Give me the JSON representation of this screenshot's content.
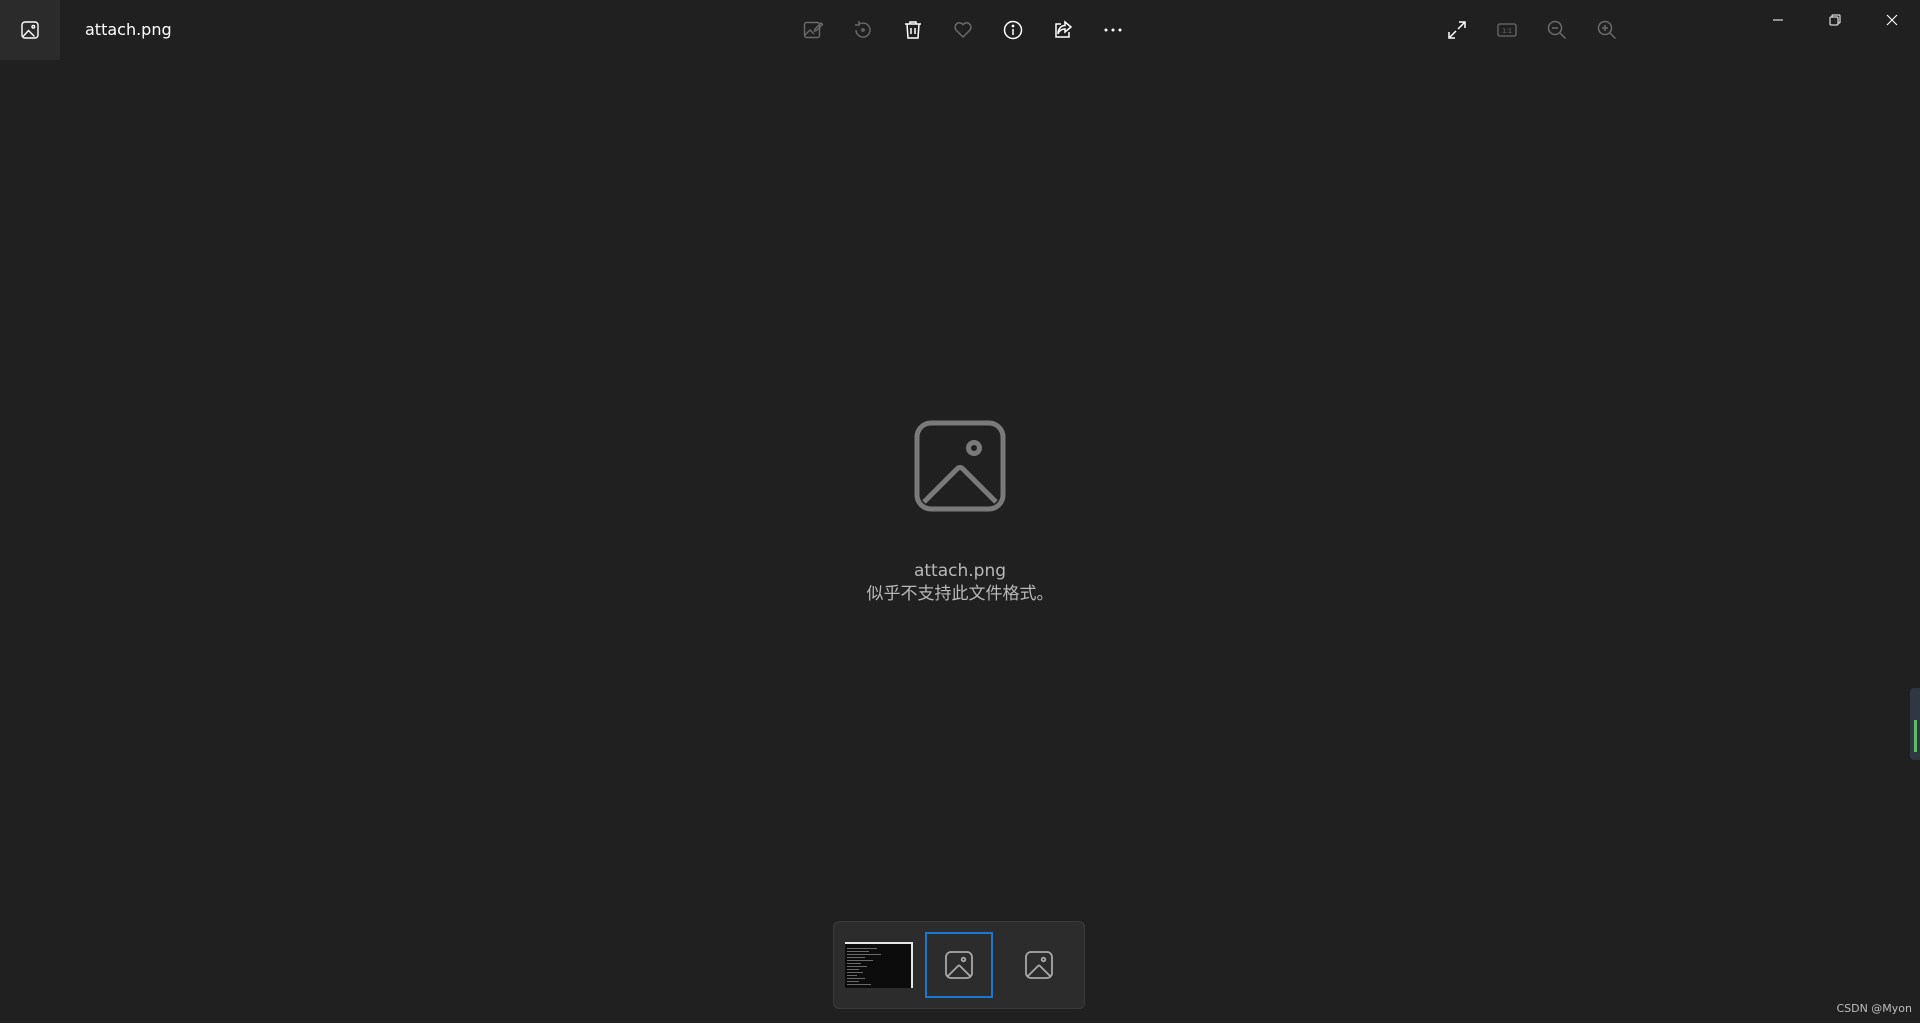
{
  "titlebar": {
    "file_name": "attach.png",
    "app_icon": "photos-app-icon"
  },
  "toolbar": {
    "center_icons": [
      "edit-image-icon",
      "rotate-icon",
      "delete-icon",
      "favorite-icon",
      "info-icon",
      "share-icon",
      "more-icon"
    ],
    "right_icons": [
      "fullscreen-icon",
      "actual-size-icon",
      "zoom-out-icon",
      "zoom-in-icon"
    ],
    "actual_size_label": "1:1"
  },
  "window_controls": [
    "minimize-icon",
    "restore-icon",
    "close-icon"
  ],
  "viewer": {
    "file_name": "attach.png",
    "error_message": "似乎不支持此文件格式。",
    "placeholder_icon": "image-placeholder-icon"
  },
  "filmstrip": {
    "selected_index": 1,
    "items": [
      {
        "kind": "screenshot-thumbnail"
      },
      {
        "kind": "image-placeholder-icon"
      },
      {
        "kind": "image-placeholder-icon"
      }
    ]
  },
  "watermark": "CSDN @Myon⁠",
  "colors": {
    "background": "#202020",
    "accent": "#1a78d2",
    "icon": "#ffffff",
    "icon_disabled": "#6b6b6b",
    "text_secondary": "#b8b8b8"
  }
}
